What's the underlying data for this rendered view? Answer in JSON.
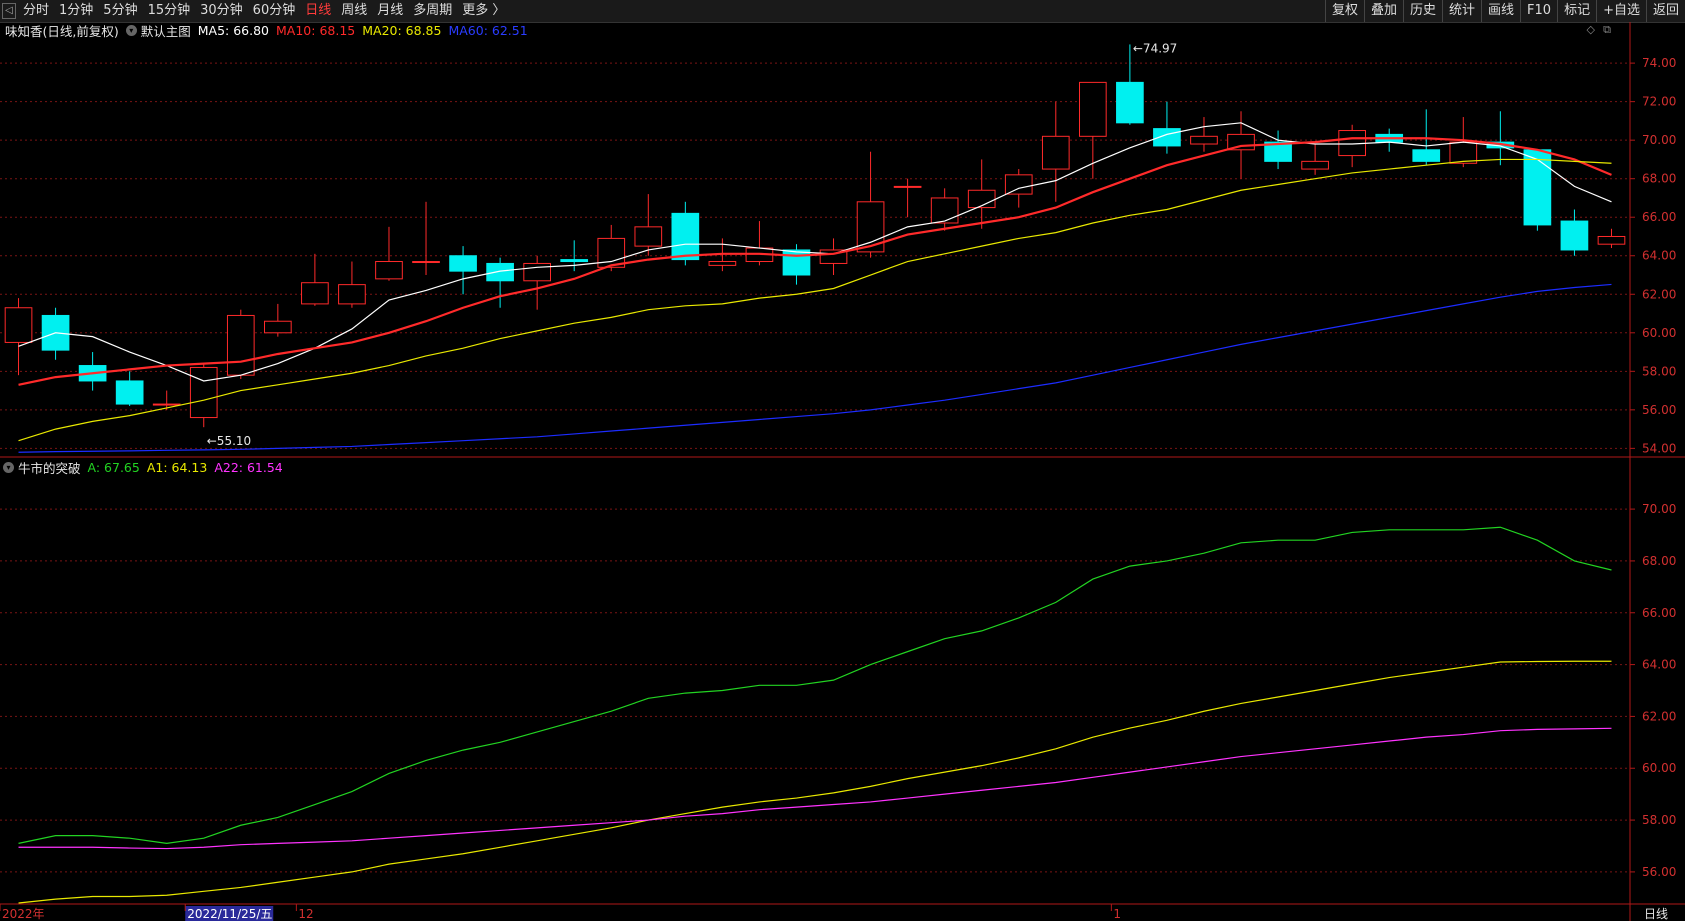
{
  "toolbar": {
    "periods": [
      {
        "label": "分时",
        "active": false
      },
      {
        "label": "1分钟",
        "active": false
      },
      {
        "label": "5分钟",
        "active": false
      },
      {
        "label": "15分钟",
        "active": false
      },
      {
        "label": "30分钟",
        "active": false
      },
      {
        "label": "60分钟",
        "active": false
      },
      {
        "label": "日线",
        "active": true
      },
      {
        "label": "周线",
        "active": false
      },
      {
        "label": "月线",
        "active": false
      },
      {
        "label": "多周期",
        "active": false
      },
      {
        "label": "更多 〉",
        "active": false
      }
    ],
    "right": [
      "复权",
      "叠加",
      "历史",
      "统计",
      "画线",
      "F10",
      "标记",
      "+自选",
      "返回"
    ]
  },
  "main_header": {
    "stock": "味知香(日线,前复权)",
    "template": "默认主图",
    "ma": [
      {
        "label": "MA5: 66.80",
        "color": "#ffffff"
      },
      {
        "label": "MA10: 68.15",
        "color": "#ff2a2a"
      },
      {
        "label": "MA20: 68.85",
        "color": "#e8e800"
      },
      {
        "label": "MA60: 62.51",
        "color": "#2a3cff"
      }
    ]
  },
  "sub_header": {
    "name": "牛市的突破",
    "lines": [
      {
        "label": "A: 67.65",
        "color": "#22d322"
      },
      {
        "label": "A1: 64.13",
        "color": "#e8e800"
      },
      {
        "label": "A22: 61.54",
        "color": "#ff33ff"
      }
    ]
  },
  "colors": {
    "up": "#ff2a2a",
    "down": "#00f0f0",
    "grid": "#7a1414",
    "axis": "#b01818"
  },
  "chart_data": {
    "main": {
      "type": "candlestick",
      "ylim": [
        53.5,
        75.2
      ],
      "yticks": [
        "54.00",
        "56.00",
        "58.00",
        "60.00",
        "62.00",
        "64.00",
        "66.00",
        "68.00",
        "70.00",
        "72.00",
        "74.00"
      ],
      "annotations": [
        {
          "label": "74.97",
          "index": 30
        },
        {
          "label": "55.10",
          "index": 5
        }
      ],
      "candles": [
        [
          59.5,
          61.3,
          57.8,
          61.8
        ],
        [
          60.9,
          59.1,
          58.6,
          61.3
        ],
        [
          58.3,
          57.5,
          57.0,
          59.0
        ],
        [
          57.5,
          56.3,
          56.2,
          58.0
        ],
        [
          56.3,
          56.3,
          56.0,
          57.0
        ],
        [
          55.6,
          58.2,
          55.1,
          58.4
        ],
        [
          57.8,
          60.9,
          57.6,
          61.2
        ],
        [
          60.0,
          60.6,
          59.8,
          61.5
        ],
        [
          61.5,
          62.6,
          61.4,
          64.1
        ],
        [
          61.5,
          62.5,
          61.3,
          63.7
        ],
        [
          62.8,
          63.7,
          62.7,
          65.5
        ],
        [
          63.7,
          63.7,
          63.0,
          66.8
        ],
        [
          64.0,
          63.2,
          62.0,
          64.5
        ],
        [
          63.6,
          62.7,
          61.3,
          63.9
        ],
        [
          62.7,
          63.6,
          61.2,
          64.0
        ],
        [
          63.8,
          63.7,
          63.2,
          64.8
        ],
        [
          63.4,
          64.9,
          63.2,
          65.6
        ],
        [
          64.5,
          65.5,
          64.0,
          67.2
        ],
        [
          66.2,
          63.8,
          63.5,
          66.8
        ],
        [
          63.5,
          63.7,
          63.2,
          64.9
        ],
        [
          63.7,
          64.4,
          63.5,
          65.8
        ],
        [
          64.3,
          63.0,
          62.5,
          64.6
        ],
        [
          63.6,
          64.3,
          63.0,
          64.9
        ],
        [
          64.2,
          66.8,
          63.9,
          69.4
        ],
        [
          67.6,
          67.6,
          66.0,
          68.0
        ],
        [
          65.7,
          67.0,
          65.3,
          67.5
        ],
        [
          66.5,
          67.4,
          65.4,
          69.0
        ],
        [
          67.2,
          68.2,
          66.5,
          68.5
        ],
        [
          68.5,
          70.2,
          66.8,
          72.0
        ],
        [
          70.2,
          73.0,
          68.0,
          73.0
        ],
        [
          73.0,
          70.9,
          70.8,
          74.97
        ],
        [
          70.6,
          69.7,
          69.3,
          72.0
        ],
        [
          69.8,
          70.2,
          69.4,
          71.2
        ],
        [
          69.5,
          70.3,
          68.0,
          71.5
        ],
        [
          69.9,
          68.9,
          68.5,
          70.5
        ],
        [
          68.5,
          68.9,
          68.2,
          69.8
        ],
        [
          69.2,
          70.5,
          68.6,
          70.8
        ],
        [
          70.3,
          69.9,
          69.4,
          70.6
        ],
        [
          69.5,
          68.9,
          68.7,
          71.6
        ],
        [
          68.8,
          69.9,
          68.6,
          71.2
        ],
        [
          69.9,
          69.6,
          68.7,
          71.5
        ],
        [
          69.5,
          65.6,
          65.3,
          69.5
        ],
        [
          65.8,
          64.3,
          64.0,
          66.4
        ],
        [
          64.6,
          65.0,
          64.4,
          65.4
        ]
      ],
      "series": [
        {
          "name": "MA5",
          "color": "#ffffff",
          "width": 1.2,
          "values": [
            59.3,
            60.0,
            59.8,
            59.0,
            58.3,
            57.5,
            57.8,
            58.4,
            59.2,
            60.2,
            61.7,
            62.2,
            62.8,
            63.2,
            63.4,
            63.5,
            63.7,
            64.3,
            64.6,
            64.6,
            64.4,
            64.2,
            64.1,
            64.7,
            65.5,
            65.8,
            66.6,
            67.5,
            67.9,
            68.8,
            69.6,
            70.3,
            70.7,
            70.9,
            70.0,
            69.8,
            69.8,
            69.9,
            69.7,
            69.9,
            69.7,
            69.0,
            67.6,
            66.8
          ]
        },
        {
          "name": "MA10",
          "color": "#ff2a2a",
          "width": 2.2,
          "values": [
            57.3,
            57.7,
            57.9,
            58.1,
            58.3,
            58.4,
            58.5,
            58.9,
            59.2,
            59.5,
            60.0,
            60.6,
            61.3,
            61.9,
            62.3,
            62.8,
            63.5,
            63.8,
            64.0,
            64.1,
            64.1,
            64.0,
            64.1,
            64.5,
            65.1,
            65.4,
            65.7,
            66.0,
            66.5,
            67.3,
            68.0,
            68.7,
            69.2,
            69.7,
            69.8,
            69.9,
            70.1,
            70.1,
            70.1,
            70.0,
            69.8,
            69.5,
            69.0,
            68.2
          ]
        },
        {
          "name": "MA20",
          "color": "#e8e800",
          "width": 1.2,
          "values": [
            54.4,
            55.0,
            55.4,
            55.7,
            56.1,
            56.5,
            57.0,
            57.3,
            57.6,
            57.9,
            58.3,
            58.8,
            59.2,
            59.7,
            60.1,
            60.5,
            60.8,
            61.2,
            61.4,
            61.5,
            61.8,
            62.0,
            62.3,
            63.0,
            63.7,
            64.1,
            64.5,
            64.9,
            65.2,
            65.7,
            66.1,
            66.4,
            66.9,
            67.4,
            67.7,
            68.0,
            68.3,
            68.5,
            68.7,
            68.9,
            69.0,
            69.0,
            68.9,
            68.8
          ]
        },
        {
          "name": "MA60",
          "color": "#1c2cff",
          "width": 1.2,
          "values": [
            53.8,
            53.83,
            53.85,
            53.87,
            53.9,
            53.92,
            53.95,
            54.0,
            54.05,
            54.1,
            54.2,
            54.3,
            54.4,
            54.5,
            54.6,
            54.75,
            54.9,
            55.05,
            55.2,
            55.35,
            55.5,
            55.65,
            55.8,
            56.0,
            56.25,
            56.5,
            56.8,
            57.1,
            57.4,
            57.8,
            58.2,
            58.6,
            59.0,
            59.4,
            59.75,
            60.1,
            60.45,
            60.8,
            61.15,
            61.5,
            61.85,
            62.15,
            62.35,
            62.51
          ]
        }
      ]
    },
    "sub": {
      "type": "line",
      "ylim": [
        54.8,
        71.2
      ],
      "yticks": [
        "56.00",
        "58.00",
        "60.00",
        "62.00",
        "64.00",
        "66.00",
        "68.00",
        "70.00"
      ],
      "series": [
        {
          "name": "A",
          "color": "#22d322",
          "values": [
            57.1,
            57.4,
            57.4,
            57.3,
            57.1,
            57.3,
            57.8,
            58.1,
            58.6,
            59.1,
            59.8,
            60.3,
            60.7,
            61.0,
            61.4,
            61.8,
            62.2,
            62.7,
            62.9,
            63.0,
            63.2,
            63.2,
            63.4,
            64.0,
            64.5,
            65.0,
            65.3,
            65.8,
            66.4,
            67.3,
            67.8,
            68.0,
            68.3,
            68.7,
            68.8,
            68.8,
            69.1,
            69.2,
            69.2,
            69.2,
            69.3,
            68.8,
            68.0,
            67.65
          ]
        },
        {
          "name": "A1",
          "color": "#e8e800",
          "values": [
            54.8,
            54.95,
            55.05,
            55.05,
            55.1,
            55.25,
            55.4,
            55.6,
            55.8,
            56.0,
            56.3,
            56.5,
            56.7,
            56.95,
            57.2,
            57.45,
            57.7,
            58.0,
            58.25,
            58.5,
            58.7,
            58.85,
            59.05,
            59.3,
            59.6,
            59.85,
            60.1,
            60.4,
            60.75,
            61.2,
            61.55,
            61.85,
            62.2,
            62.5,
            62.75,
            63.0,
            63.25,
            63.5,
            63.7,
            63.9,
            64.1,
            64.12,
            64.13,
            64.13
          ]
        },
        {
          "name": "A22",
          "color": "#ff33ff",
          "values": [
            56.95,
            56.95,
            56.95,
            56.92,
            56.9,
            56.95,
            57.05,
            57.1,
            57.15,
            57.2,
            57.3,
            57.4,
            57.5,
            57.6,
            57.7,
            57.8,
            57.9,
            58.0,
            58.15,
            58.25,
            58.4,
            58.5,
            58.6,
            58.7,
            58.85,
            59.0,
            59.15,
            59.3,
            59.45,
            59.65,
            59.85,
            60.05,
            60.25,
            60.45,
            60.6,
            60.75,
            60.9,
            61.05,
            61.2,
            61.3,
            61.45,
            61.5,
            61.52,
            61.54
          ]
        }
      ]
    },
    "xlabels": [
      {
        "label": "2022年",
        "index": 0
      },
      {
        "label": "2022/11/25/五",
        "index": 5
      },
      {
        "label": "12",
        "index": 8
      },
      {
        "label": "1",
        "index": 30
      }
    ],
    "period_label": "日线"
  }
}
